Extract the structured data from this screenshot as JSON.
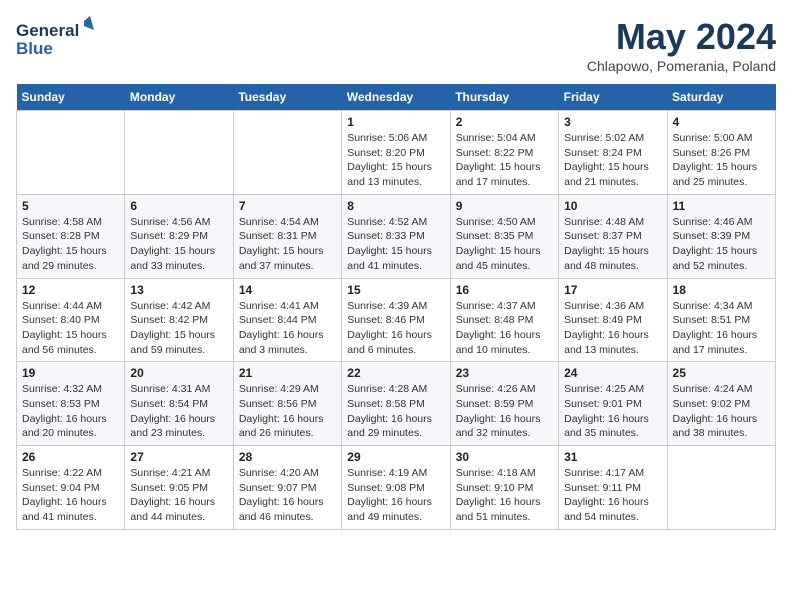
{
  "header": {
    "logo_line1": "General",
    "logo_line2": "Blue",
    "month": "May 2024",
    "location": "Chlapowo, Pomerania, Poland"
  },
  "weekdays": [
    "Sunday",
    "Monday",
    "Tuesday",
    "Wednesday",
    "Thursday",
    "Friday",
    "Saturday"
  ],
  "weeks": [
    [
      {
        "day": "",
        "info": ""
      },
      {
        "day": "",
        "info": ""
      },
      {
        "day": "",
        "info": ""
      },
      {
        "day": "1",
        "info": "Sunrise: 5:06 AM\nSunset: 8:20 PM\nDaylight: 15 hours\nand 13 minutes."
      },
      {
        "day": "2",
        "info": "Sunrise: 5:04 AM\nSunset: 8:22 PM\nDaylight: 15 hours\nand 17 minutes."
      },
      {
        "day": "3",
        "info": "Sunrise: 5:02 AM\nSunset: 8:24 PM\nDaylight: 15 hours\nand 21 minutes."
      },
      {
        "day": "4",
        "info": "Sunrise: 5:00 AM\nSunset: 8:26 PM\nDaylight: 15 hours\nand 25 minutes."
      }
    ],
    [
      {
        "day": "5",
        "info": "Sunrise: 4:58 AM\nSunset: 8:28 PM\nDaylight: 15 hours\nand 29 minutes."
      },
      {
        "day": "6",
        "info": "Sunrise: 4:56 AM\nSunset: 8:29 PM\nDaylight: 15 hours\nand 33 minutes."
      },
      {
        "day": "7",
        "info": "Sunrise: 4:54 AM\nSunset: 8:31 PM\nDaylight: 15 hours\nand 37 minutes."
      },
      {
        "day": "8",
        "info": "Sunrise: 4:52 AM\nSunset: 8:33 PM\nDaylight: 15 hours\nand 41 minutes."
      },
      {
        "day": "9",
        "info": "Sunrise: 4:50 AM\nSunset: 8:35 PM\nDaylight: 15 hours\nand 45 minutes."
      },
      {
        "day": "10",
        "info": "Sunrise: 4:48 AM\nSunset: 8:37 PM\nDaylight: 15 hours\nand 48 minutes."
      },
      {
        "day": "11",
        "info": "Sunrise: 4:46 AM\nSunset: 8:39 PM\nDaylight: 15 hours\nand 52 minutes."
      }
    ],
    [
      {
        "day": "12",
        "info": "Sunrise: 4:44 AM\nSunset: 8:40 PM\nDaylight: 15 hours\nand 56 minutes."
      },
      {
        "day": "13",
        "info": "Sunrise: 4:42 AM\nSunset: 8:42 PM\nDaylight: 15 hours\nand 59 minutes."
      },
      {
        "day": "14",
        "info": "Sunrise: 4:41 AM\nSunset: 8:44 PM\nDaylight: 16 hours\nand 3 minutes."
      },
      {
        "day": "15",
        "info": "Sunrise: 4:39 AM\nSunset: 8:46 PM\nDaylight: 16 hours\nand 6 minutes."
      },
      {
        "day": "16",
        "info": "Sunrise: 4:37 AM\nSunset: 8:48 PM\nDaylight: 16 hours\nand 10 minutes."
      },
      {
        "day": "17",
        "info": "Sunrise: 4:36 AM\nSunset: 8:49 PM\nDaylight: 16 hours\nand 13 minutes."
      },
      {
        "day": "18",
        "info": "Sunrise: 4:34 AM\nSunset: 8:51 PM\nDaylight: 16 hours\nand 17 minutes."
      }
    ],
    [
      {
        "day": "19",
        "info": "Sunrise: 4:32 AM\nSunset: 8:53 PM\nDaylight: 16 hours\nand 20 minutes."
      },
      {
        "day": "20",
        "info": "Sunrise: 4:31 AM\nSunset: 8:54 PM\nDaylight: 16 hours\nand 23 minutes."
      },
      {
        "day": "21",
        "info": "Sunrise: 4:29 AM\nSunset: 8:56 PM\nDaylight: 16 hours\nand 26 minutes."
      },
      {
        "day": "22",
        "info": "Sunrise: 4:28 AM\nSunset: 8:58 PM\nDaylight: 16 hours\nand 29 minutes."
      },
      {
        "day": "23",
        "info": "Sunrise: 4:26 AM\nSunset: 8:59 PM\nDaylight: 16 hours\nand 32 minutes."
      },
      {
        "day": "24",
        "info": "Sunrise: 4:25 AM\nSunset: 9:01 PM\nDaylight: 16 hours\nand 35 minutes."
      },
      {
        "day": "25",
        "info": "Sunrise: 4:24 AM\nSunset: 9:02 PM\nDaylight: 16 hours\nand 38 minutes."
      }
    ],
    [
      {
        "day": "26",
        "info": "Sunrise: 4:22 AM\nSunset: 9:04 PM\nDaylight: 16 hours\nand 41 minutes."
      },
      {
        "day": "27",
        "info": "Sunrise: 4:21 AM\nSunset: 9:05 PM\nDaylight: 16 hours\nand 44 minutes."
      },
      {
        "day": "28",
        "info": "Sunrise: 4:20 AM\nSunset: 9:07 PM\nDaylight: 16 hours\nand 46 minutes."
      },
      {
        "day": "29",
        "info": "Sunrise: 4:19 AM\nSunset: 9:08 PM\nDaylight: 16 hours\nand 49 minutes."
      },
      {
        "day": "30",
        "info": "Sunrise: 4:18 AM\nSunset: 9:10 PM\nDaylight: 16 hours\nand 51 minutes."
      },
      {
        "day": "31",
        "info": "Sunrise: 4:17 AM\nSunset: 9:11 PM\nDaylight: 16 hours\nand 54 minutes."
      },
      {
        "day": "",
        "info": ""
      }
    ]
  ]
}
